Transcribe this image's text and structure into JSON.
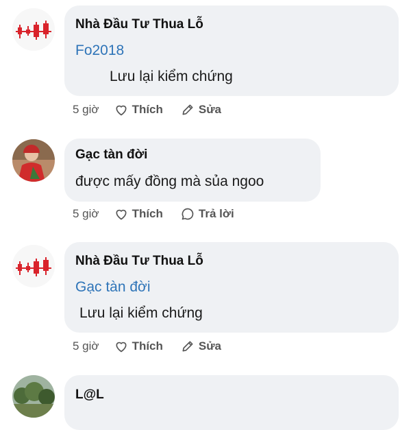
{
  "comments": [
    {
      "author": "Nhà Đầu Tư Thua Lỗ",
      "mention": "Fo2018",
      "text": "Lưu lại kiểm chứng",
      "time": "5 giờ",
      "like_label": "Thích",
      "second_action_label": "Sửa",
      "second_action_icon": "pencil-icon",
      "avatar_icon": "candlestick-chart-icon"
    },
    {
      "author": "Gạc tàn đời",
      "text": "được mấy đồng mà sủa ngoo",
      "time": "5 giờ",
      "like_label": "Thích",
      "second_action_label": "Trả lời",
      "second_action_icon": "reply-bubble-icon",
      "avatar_icon": "person-photo-icon"
    },
    {
      "author": "Nhà Đầu Tư Thua Lỗ",
      "mention": "Gạc tàn đời",
      "text": "Lưu lại kiểm chứng",
      "time": "5 giờ",
      "like_label": "Thích",
      "second_action_label": "Sửa",
      "second_action_icon": "pencil-icon",
      "avatar_icon": "candlestick-chart-icon"
    },
    {
      "author": "L@L",
      "avatar_icon": "tree-photo-icon"
    }
  ],
  "colors": {
    "bubble": "#eff1f4",
    "mention": "#2e74b8",
    "candle_red": "#d9232b"
  }
}
